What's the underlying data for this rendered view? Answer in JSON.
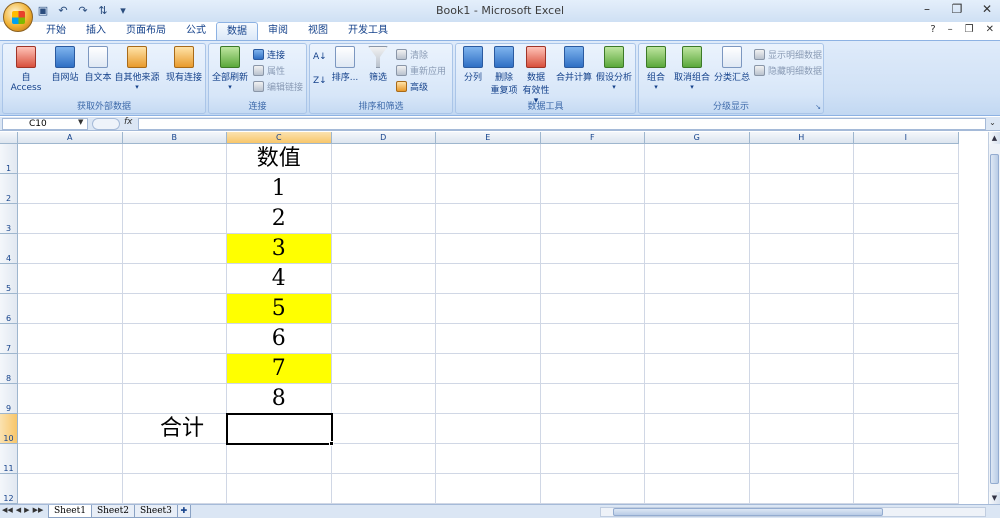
{
  "app": {
    "title": "Book1 - Microsoft Excel",
    "window_controls": [
      "–",
      "❐",
      "✕"
    ],
    "help_controls": [
      "?",
      "–",
      "❐",
      "✕"
    ]
  },
  "quick_access": {
    "items": [
      "save-icon",
      "undo-icon",
      "redo-icon",
      "sort-icon",
      "customize-icon"
    ]
  },
  "tabs": [
    {
      "label": "开始",
      "active": false
    },
    {
      "label": "插入",
      "active": false
    },
    {
      "label": "页面布局",
      "active": false
    },
    {
      "label": "公式",
      "active": false
    },
    {
      "label": "数据",
      "active": true
    },
    {
      "label": "审阅",
      "active": false
    },
    {
      "label": "视图",
      "active": false
    },
    {
      "label": "开发工具",
      "active": false
    }
  ],
  "ribbon": {
    "external": {
      "label": "获取外部数据",
      "access": "自 Access",
      "web": "自网站",
      "text": "自文本",
      "other": "自其他来源",
      "existing": "现有连接"
    },
    "connections": {
      "label": "连接",
      "refresh_all": "全部刷新",
      "connections": "连接",
      "properties": "属性",
      "edit_links": "编辑链接"
    },
    "sort_filter": {
      "label": "排序和筛选",
      "sort": "排序...",
      "filter": "筛选",
      "clear": "清除",
      "reapply": "重新应用",
      "advanced": "高级"
    },
    "data_tools": {
      "label": "数据工具",
      "text_to_columns": "分列",
      "remove_dup_1": "删除",
      "remove_dup_2": "重复项",
      "validation_1": "数据",
      "validation_2": "有效性",
      "consolidate": "合并计算",
      "what_if": "假设分析"
    },
    "outline": {
      "label": "分级显示",
      "group": "组合",
      "ungroup": "取消组合",
      "subtotal": "分类汇总",
      "show_detail": "显示明细数据",
      "hide_detail": "隐藏明细数据"
    }
  },
  "formula_bar": {
    "name_box": "C10",
    "fx": "fx",
    "value": ""
  },
  "columns": [
    "A",
    "B",
    "C",
    "D",
    "E",
    "F",
    "G",
    "H",
    "I"
  ],
  "rows": [
    "1",
    "2",
    "3",
    "4",
    "5",
    "6",
    "7",
    "8",
    "9",
    "10",
    "11",
    "12"
  ],
  "cells": {
    "header": "数值",
    "values": [
      "1",
      "2",
      "3",
      "4",
      "5",
      "6",
      "7",
      "8"
    ],
    "highlighted": [
      false,
      false,
      true,
      false,
      true,
      false,
      true,
      false
    ],
    "total_label": "合计",
    "total_value": ""
  },
  "highlight_color": "#ffff00",
  "selected_cell": "C10",
  "sheets": [
    {
      "name": "Sheet1",
      "active": true
    },
    {
      "name": "Sheet2",
      "active": false
    },
    {
      "name": "Sheet3",
      "active": false
    }
  ]
}
